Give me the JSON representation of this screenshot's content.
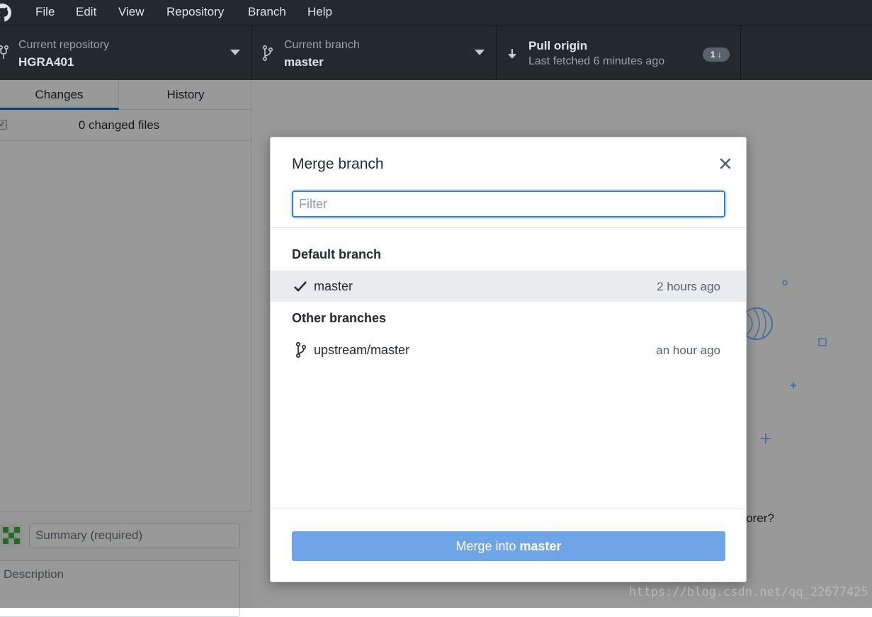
{
  "menubar": {
    "items": [
      "File",
      "Edit",
      "View",
      "Repository",
      "Branch",
      "Help"
    ]
  },
  "toolbar": {
    "repo": {
      "label": "Current repository",
      "value": "HGRA401"
    },
    "branch": {
      "label": "Current branch",
      "value": "master"
    },
    "pull": {
      "label": "Pull origin",
      "sub": "Last fetched 6 minutes ago",
      "badge": "1"
    }
  },
  "sidebar": {
    "tabs": [
      "Changes",
      "History"
    ],
    "changed_files": "0 changed files",
    "summary_placeholder": "Summary (required)",
    "description_placeholder": "Description"
  },
  "background": {
    "explorer_text": "plorer?"
  },
  "dialog": {
    "title": "Merge branch",
    "filter_placeholder": "Filter",
    "default_heading": "Default branch",
    "default_branch": {
      "name": "master",
      "time": "2 hours ago"
    },
    "other_heading": "Other branches",
    "other_branches": [
      {
        "name": "upstream/master",
        "time": "an hour ago"
      }
    ],
    "merge_button_prefix": "Merge into",
    "merge_button_branch": "master"
  },
  "watermark": "https://blog.csdn.net/qq_22677425",
  "colors": {
    "titlebar": "#24292e",
    "accent": "#0366d6",
    "merge_button": "#6fa5e6",
    "selected_row": "#e9ecef"
  }
}
